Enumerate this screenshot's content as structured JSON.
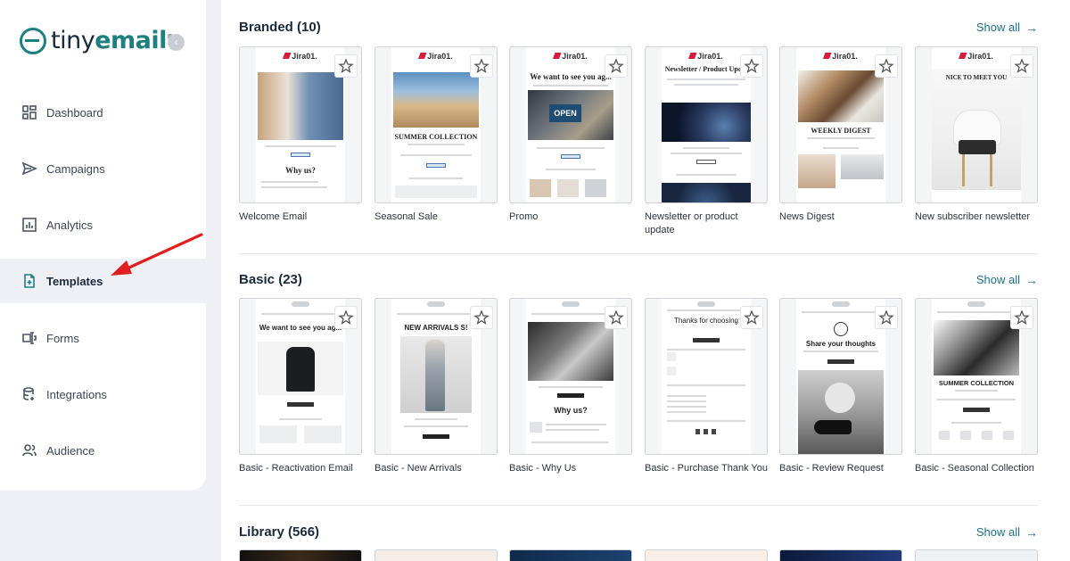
{
  "brand": {
    "name_pre": "tiny",
    "name_bold": "email",
    "reg": "®"
  },
  "nav": [
    {
      "label": "Dashboard",
      "icon": "dashboard-icon"
    },
    {
      "label": "Campaigns",
      "icon": "send-icon"
    },
    {
      "label": "Analytics",
      "icon": "chart-icon"
    },
    {
      "label": "Templates",
      "icon": "template-icon",
      "active": true
    },
    {
      "label": "Forms",
      "icon": "form-icon"
    },
    {
      "label": "Integrations",
      "icon": "database-icon"
    },
    {
      "label": "Audience",
      "icon": "users-icon"
    }
  ],
  "accent": "#1e7f80",
  "annotation_color": "#e02020",
  "sections": [
    {
      "title": "Branded",
      "count": "(10)",
      "show_all": "Show all",
      "templates": [
        {
          "label": "Welcome Email",
          "thumb_heading": "Why us?"
        },
        {
          "label": "Seasonal Sale",
          "thumb_heading": "SUMMER COLLECTION"
        },
        {
          "label": "Promo",
          "thumb_heading": "We want to see you ag..."
        },
        {
          "label": "Newsletter or product update",
          "thumb_heading": "Newsletter / Product Upd..."
        },
        {
          "label": "News Digest",
          "thumb_heading": "WEEKLY DIGEST"
        },
        {
          "label": "New subscriber newsletter",
          "thumb_heading": "NICE TO MEET YOU"
        }
      ]
    },
    {
      "title": "Basic",
      "count": "(23)",
      "show_all": "Show all",
      "templates": [
        {
          "label": "Basic - Reactivation Email",
          "thumb_heading": "We want to see you ag..."
        },
        {
          "label": "Basic - New Arrivals",
          "thumb_heading": "NEW ARRIVALS S!"
        },
        {
          "label": "Basic - Why Us",
          "thumb_heading": "Why us?"
        },
        {
          "label": "Basic - Purchase Thank You",
          "thumb_heading": "Thanks for choosing"
        },
        {
          "label": "Basic - Review Request",
          "thumb_heading": "Share your thoughts"
        },
        {
          "label": "Basic - Seasonal Collection",
          "thumb_heading": "SUMMER COLLECTION"
        }
      ]
    },
    {
      "title": "Library",
      "count": "(566)",
      "show_all": "Show all"
    }
  ],
  "brand_logo_text": "Jira01."
}
